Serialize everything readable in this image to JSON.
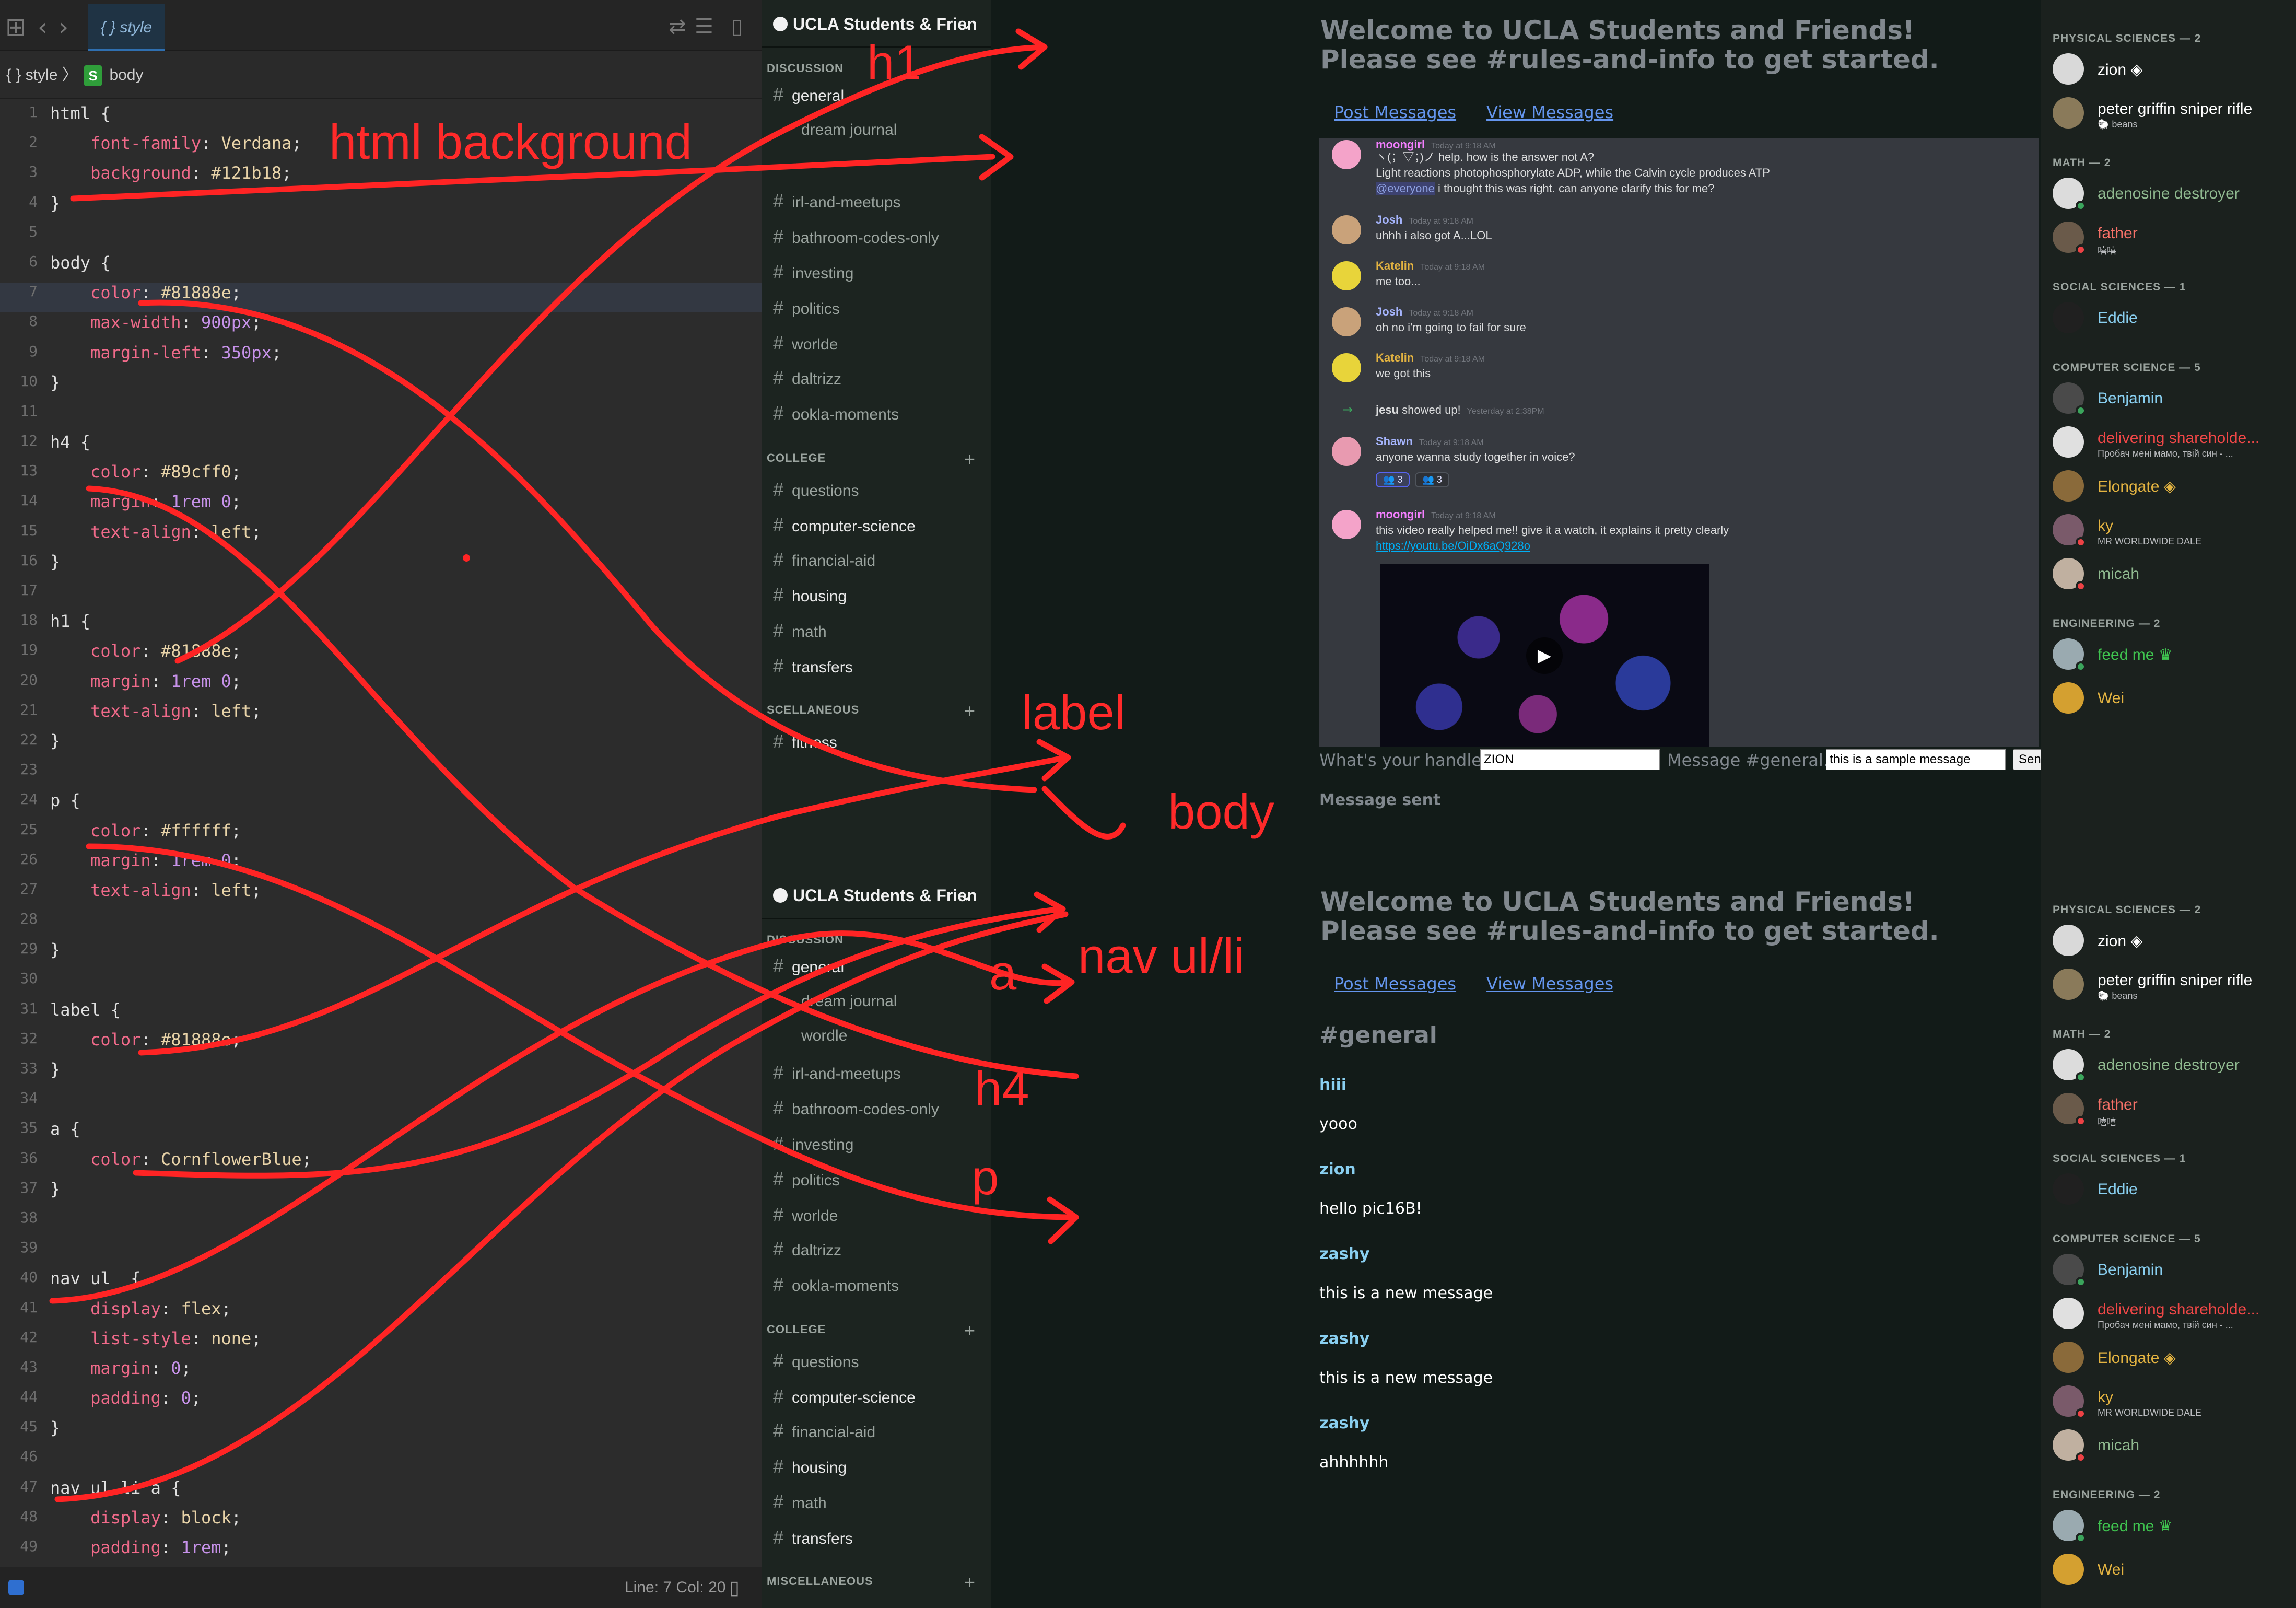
{
  "editor": {
    "tab": "{ } style",
    "breadcrumb_root": "{ } style",
    "breadcrumb_sep": "〉",
    "breadcrumb_badge": "S",
    "breadcrumb_leaf": "body",
    "status_text": "Line: 7  Col: 20",
    "lines": [
      {
        "n": "1",
        "html": "html {"
      },
      {
        "n": "2",
        "html": "    <span class='prop'>font-family</span>: <span class='val'>Verdana</span>;"
      },
      {
        "n": "3",
        "html": "    <span class='prop'>background</span>: <span class='val'>#121b18</span>;"
      },
      {
        "n": "4",
        "html": "}"
      },
      {
        "n": "5",
        "html": ""
      },
      {
        "n": "6",
        "html": "body {"
      },
      {
        "n": "7",
        "html": "    <span class='prop'>color</span>: <span class='val'>#81888e</span>;",
        "current": true
      },
      {
        "n": "8",
        "html": "    <span class='prop'>max-width</span>: <span class='num'>900px</span>;"
      },
      {
        "n": "9",
        "html": "    <span class='prop'>margin-left</span>: <span class='num'>350px</span>;"
      },
      {
        "n": "10",
        "html": "}"
      },
      {
        "n": "11",
        "html": ""
      },
      {
        "n": "12",
        "html": "h4 {"
      },
      {
        "n": "13",
        "html": "    <span class='prop'>color</span>: <span class='val'>#89cff0</span>;"
      },
      {
        "n": "14",
        "html": "    <span class='prop'>margin</span>: <span class='num'>1rem 0</span>;"
      },
      {
        "n": "15",
        "html": "    <span class='prop'>text-align</span>: <span class='val'>left</span>;"
      },
      {
        "n": "16",
        "html": "}"
      },
      {
        "n": "17",
        "html": ""
      },
      {
        "n": "18",
        "html": "h1 {"
      },
      {
        "n": "19",
        "html": "    <span class='prop'>color</span>: <span class='val'>#81888e</span>;"
      },
      {
        "n": "20",
        "html": "    <span class='prop'>margin</span>: <span class='num'>1rem 0</span>;"
      },
      {
        "n": "21",
        "html": "    <span class='prop'>text-align</span>: <span class='val'>left</span>;"
      },
      {
        "n": "22",
        "html": "}"
      },
      {
        "n": "23",
        "html": ""
      },
      {
        "n": "24",
        "html": "p {"
      },
      {
        "n": "25",
        "html": "    <span class='prop'>color</span>: <span class='val'>#ffffff</span>;"
      },
      {
        "n": "26",
        "html": "    <span class='prop'>margin</span>: <span class='num'>1rem 0</span>;"
      },
      {
        "n": "27",
        "html": "    <span class='prop'>text-align</span>: <span class='val'>left</span>;"
      },
      {
        "n": "28",
        "html": ""
      },
      {
        "n": "29",
        "html": "}"
      },
      {
        "n": "30",
        "html": ""
      },
      {
        "n": "31",
        "html": "label {"
      },
      {
        "n": "32",
        "html": "    <span class='prop'>color</span>: <span class='val'>#81888e</span>;"
      },
      {
        "n": "33",
        "html": "}"
      },
      {
        "n": "34",
        "html": ""
      },
      {
        "n": "35",
        "html": "a {"
      },
      {
        "n": "36",
        "html": "    <span class='prop'>color</span>: <span class='val'>CornflowerBlue</span>;"
      },
      {
        "n": "37",
        "html": "}"
      },
      {
        "n": "38",
        "html": ""
      },
      {
        "n": "39",
        "html": ""
      },
      {
        "n": "40",
        "html": "nav ul  {"
      },
      {
        "n": "41",
        "html": "    <span class='prop'>display</span>: <span class='val'>flex</span>;"
      },
      {
        "n": "42",
        "html": "    <span class='prop'>list-style</span>: <span class='val'>none</span>;"
      },
      {
        "n": "43",
        "html": "    <span class='prop'>margin</span>: <span class='num'>0</span>;"
      },
      {
        "n": "44",
        "html": "    <span class='prop'>padding</span>: <span class='num'>0</span>;"
      },
      {
        "n": "45",
        "html": "}"
      },
      {
        "n": "46",
        "html": ""
      },
      {
        "n": "47",
        "html": "nav ul li a {"
      },
      {
        "n": "48",
        "html": "    <span class='prop'>display</span>: <span class='val'>block</span>;"
      },
      {
        "n": "49",
        "html": "    <span class='prop'>padding</span>: <span class='num'>1rem</span>;"
      }
    ]
  },
  "server": {
    "name": "UCLA Students & Frien",
    "categories": {
      "discussion": "DISCUSSION",
      "college": "COLLEGE",
      "misc1": "SCELLANEOUS",
      "misc2": "MISCELLANEOUS"
    },
    "channels": {
      "general": "general",
      "dream_journal": "dream journal",
      "wordle_thread": "wordle",
      "irl": "irl-and-meetups",
      "bathroom": "bathroom-codes-only",
      "investing": "investing",
      "politics": "politics",
      "worlde": "worlde",
      "daltrizz": "daltrizz",
      "ookla": "ookla-moments",
      "questions": "questions",
      "cs": "computer-science",
      "finaid": "financial-aid",
      "housing": "housing",
      "math": "math",
      "transfers": "transfers",
      "fitness": "fitness"
    }
  },
  "page": {
    "h1_line1": "Welcome to UCLA Students and Friends!",
    "h1_line2": "Please see #rules-and-info to get started.",
    "nav_post": "Post Messages",
    "nav_view": "View Messages",
    "handle_label": "What's your handle?",
    "handle_value": "ZION",
    "message_label": "Message #general...",
    "message_value": "this is a sample message",
    "send_button": "Send Message",
    "status": "Message sent",
    "feed_title": "#general",
    "feed": [
      {
        "handle": "hiii",
        "text": "yooo"
      },
      {
        "handle": "zion",
        "text": "hello pic16B!"
      },
      {
        "handle": "zashy",
        "text": "this is a new message"
      },
      {
        "handle": "zashy",
        "text": "this is a new message"
      },
      {
        "handle": "zashy",
        "text": "ahhhhhh"
      }
    ]
  },
  "embed": {
    "messages": [
      {
        "author": "moongirl",
        "ts": "Today at 9:18 AM",
        "color": "#f47fff",
        "av": "#f4a3c9",
        "lines": [
          "ヽ(；▽；)ノ help. how is the answer not A?",
          "  Light reactions photophosphorylate ADP, while the Calvin cycle produces ATP"
        ],
        "mention": "@everyone",
        "mention_rest": " i thought this was right. can anyone clarify this for me?"
      },
      {
        "author": "Josh",
        "ts": "Today at 9:18 AM",
        "color": "#a5b4fc",
        "av": "#c9a27a",
        "lines": [
          "uhhh i also got A...LOL"
        ]
      },
      {
        "author": "Katelin",
        "ts": "Today at 9:18 AM",
        "color": "#e3b341",
        "av": "#e8d43a",
        "lines": [
          "me too..."
        ]
      },
      {
        "author": "Josh",
        "ts": "Today at 9:18 AM",
        "color": "#a5b4fc",
        "av": "#c9a27a",
        "lines": [
          "oh no i'm going to fail for sure"
        ]
      },
      {
        "author": "Katelin",
        "ts": "Today at 9:18 AM",
        "color": "#e3b341",
        "av": "#e8d43a",
        "lines": [
          "we got this"
        ]
      },
      {
        "join_name": "jesu",
        "join_text": " showed up!",
        "ts": "Yesterday at 2:38PM"
      },
      {
        "author": "Shawn",
        "ts": "Today at 9:18 AM",
        "color": "#a5b4fc",
        "av": "#e89ab0",
        "lines": [
          "anyone wanna study together in voice?"
        ],
        "reactions": [
          "👥 3",
          "👥 3"
        ]
      },
      {
        "author": "moongirl",
        "ts": "Today at 9:18 AM",
        "color": "#f47fff",
        "av": "#f4a3c9",
        "lines": [
          "this video really helped me!! give it a watch, it explains it pretty clearly"
        ],
        "link": "https://youtu.be/OiDx6aQ928o"
      }
    ]
  },
  "members": {
    "groups": [
      {
        "title": "PHYSICAL SCIENCES — 2",
        "members": [
          {
            "name": "zion",
            "color": "#ffffff",
            "badge": "◈",
            "av": "#d9d9d9"
          },
          {
            "name": "peter griffin sniper rifle",
            "sub": "🐑 beans",
            "color": "#ffffff",
            "av": "#8a7a5a"
          }
        ]
      },
      {
        "title": "MATH — 2",
        "members": [
          {
            "name": "adenosine destroyer",
            "color": "#8fb98f",
            "av": "#dcdcdc",
            "status": "#3ba55c"
          },
          {
            "name": "father",
            "sub": "嘻嘻",
            "color": "#f47067",
            "av": "#6a5a4a",
            "status": "#ed4245"
          }
        ]
      },
      {
        "title": "SOCIAL SCIENCES — 1",
        "members": [
          {
            "name": "Eddie",
            "color": "#89cff0",
            "av": "#202020"
          }
        ]
      },
      {
        "title": "COMPUTER SCIENCE — 5",
        "members": [
          {
            "name": "Benjamin",
            "color": "#89cff0",
            "av": "#4a4a4a",
            "status": "#3ba55c"
          },
          {
            "name": "delivering shareholde...",
            "sub": "Пробач мені мамо, твій син - ...",
            "color": "#f04747",
            "av": "#e0e0e0"
          },
          {
            "name": "Elongate",
            "color": "#e3b341",
            "badge": "◈",
            "av": "#8a6a3a"
          },
          {
            "name": "ky",
            "sub": "MR WORLDWIDE DALE",
            "color": "#e3b341",
            "av": "#7a5a6a",
            "status": "#ed4245"
          },
          {
            "name": "micah",
            "color": "#8fb98f",
            "av": "#c0b0a0",
            "status": "#ed4245"
          }
        ]
      },
      {
        "title": "ENGINEERING — 2",
        "members": [
          {
            "name": "feed me",
            "badge": "♛",
            "color": "#3fc34f",
            "av": "#9aaab0",
            "status": "#3ba55c"
          },
          {
            "name": "Wei",
            "color": "#e3b341",
            "av": "#d4a030"
          }
        ]
      }
    ]
  },
  "annotations": {
    "html_background": "html background",
    "h1": "h1",
    "label": "label",
    "body": "body",
    "a": "a",
    "nav": "nav ul/li",
    "h4": "h4",
    "p": "p"
  }
}
